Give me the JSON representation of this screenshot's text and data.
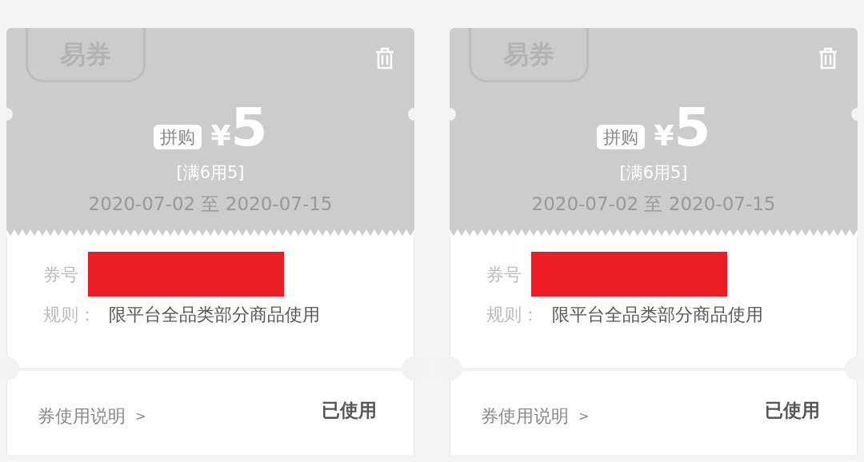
{
  "coupons": [
    {
      "stamp": "易券",
      "used": true,
      "tag": "拼购",
      "currency": "¥",
      "amount": "5",
      "condition": "[满6用5]",
      "validity": "2020-07-02 至 2020-07-15",
      "number_label": "券号",
      "rule_label": "规则：",
      "rule": "限平台全品类部分商品使用",
      "instructions_link": "券使用说明",
      "chevron": ">",
      "status": "已使用"
    },
    {
      "stamp": "易券",
      "used": true,
      "tag": "拼购",
      "currency": "¥",
      "amount": "5",
      "condition": "[满6用5]",
      "validity": "2020-07-02 至 2020-07-15",
      "number_label": "券号",
      "rule_label": "规则：",
      "rule": "限平台全品类部分商品使用",
      "instructions_link": "券使用说明",
      "chevron": ">",
      "status": "已使用"
    }
  ]
}
